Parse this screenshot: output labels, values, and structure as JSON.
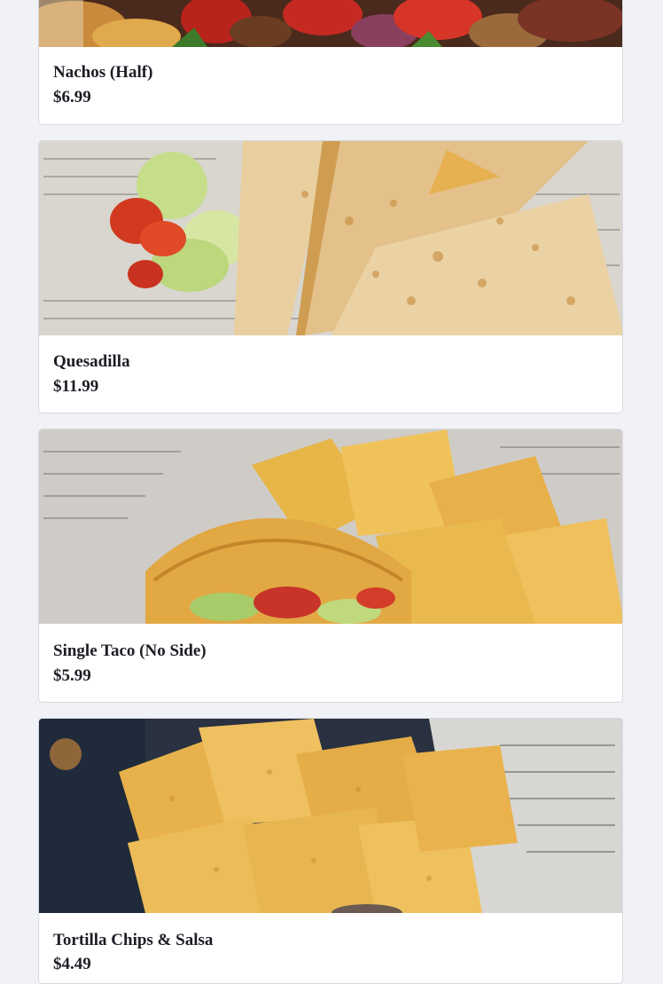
{
  "menu_items": [
    {
      "name": "Nachos (Half)",
      "price": "$6.99",
      "image": "nachos-photo"
    },
    {
      "name": "Quesadilla",
      "price": "$11.99",
      "image": "quesadilla-photo"
    },
    {
      "name": "Single Taco (No Side)",
      "price": "$5.99",
      "image": "taco-photo"
    },
    {
      "name": "Tortilla Chips & Salsa",
      "price": "$4.49",
      "image": "chips-salsa-photo"
    }
  ]
}
